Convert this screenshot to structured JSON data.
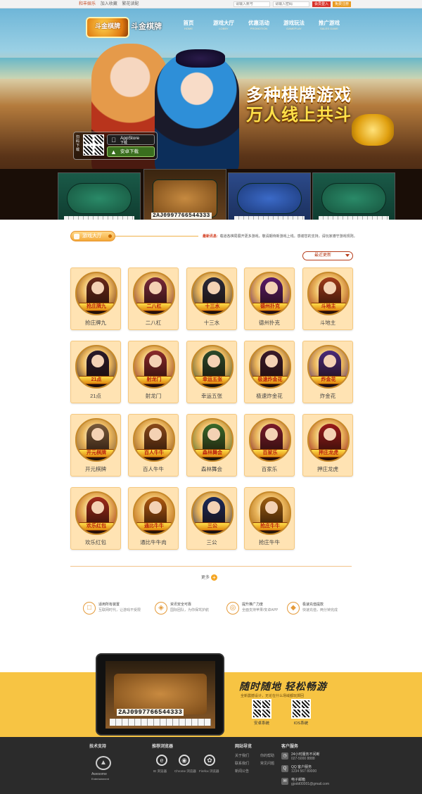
{
  "topbar": {
    "links": [
      "和丰娱乐",
      "加入收藏",
      "繁花读配"
    ],
    "username_placeholder": "请输入账号",
    "password_placeholder": "请输入密码",
    "login_label": "会员登入",
    "register_label": "免费注册"
  },
  "header": {
    "logo_text": "斗金棋牌",
    "logo_en": "DOUJINQIPAI",
    "brand": "斗金棋牌",
    "nav": [
      {
        "cn": "首页",
        "en": "HOME"
      },
      {
        "cn": "游戏大厅",
        "en": "LOBBY"
      },
      {
        "cn": "优惠活动",
        "en": "PROMOTION"
      },
      {
        "cn": "游戏玩法",
        "en": "GAMEPLAY"
      },
      {
        "cn": "推广游戏",
        "en": "SALES GAME"
      }
    ]
  },
  "hero": {
    "slogan_line1": "多种棋牌游戏",
    "slogan_line2": "万人线上共斗",
    "scan_label": "扫码下载",
    "appstore_label": "AppStore",
    "appstore_sub": "下载",
    "android_label": "安卓下载",
    "card_text": "2AJ0997766544333"
  },
  "section": {
    "title": "游戏大厅",
    "news_label": "最新讯息:",
    "news_text": "载道各棋局展开更多游戏，敬请期待新游戏上线。感谢您的支持，请玩家遵守游戏规则。",
    "sort_label": "最近更新"
  },
  "games": [
    {
      "name": "抢庄牌九",
      "banner": "抢庄牌九",
      "color": "#6a2a1a"
    },
    {
      "name": "二八杠",
      "banner": "二八杠",
      "color": "#7a2a3a"
    },
    {
      "name": "十三水",
      "banner": "十三水",
      "color": "#2a2a3a"
    },
    {
      "name": "德州扑克",
      "banner": "德州扑克",
      "color": "#5a1a6a"
    },
    {
      "name": "斗地主",
      "banner": "斗地主",
      "color": "#a03a1a"
    },
    {
      "name": "21点",
      "banner": "21点",
      "color": "#2a1a2a"
    },
    {
      "name": "射龙门",
      "banner": "射龙门",
      "color": "#8a2a2a"
    },
    {
      "name": "幸运五张",
      "banner": "幸运五张",
      "color": "#2a4a2a"
    },
    {
      "name": "极速炸金花",
      "banner": "极速炸金花",
      "color": "#3a1a2a"
    },
    {
      "name": "炸金花",
      "banner": "炸金花",
      "color": "#4a2a7a"
    },
    {
      "name": "开元棋牌",
      "banner": "开元棋牌",
      "color": "#7a5a3a"
    },
    {
      "name": "百人牛牛",
      "banner": "百人牛牛",
      "color": "#8a4a1a"
    },
    {
      "name": "森林舞会",
      "banner": "森林舞会",
      "color": "#3a6a2a"
    },
    {
      "name": "百家乐",
      "banner": "百家乐",
      "color": "#7a1a2a"
    },
    {
      "name": "押庄龙虎",
      "banner": "押庄龙虎",
      "color": "#9a1a1a"
    },
    {
      "name": "欢乐红包",
      "banner": "欢乐红包",
      "color": "#a02a1a"
    },
    {
      "name": "通比牛牛肉",
      "banner": "通比牛牛",
      "color": "#b05a10"
    },
    {
      "name": "三公",
      "banner": "三公",
      "color": "#1a2a5a"
    },
    {
      "name": "抢庄牛牛",
      "banner": "抢庄牛牛",
      "color": "#a06010"
    }
  ],
  "more_label": "更多",
  "features": [
    {
      "t1": "适用所有装置",
      "t2": "互联网时代，让游戏不受限",
      "icon": "□"
    },
    {
      "t1": "资讯安全可靠",
      "t2": "国际团队，为你保驾护航",
      "icon": "◈"
    },
    {
      "t1": "提升推广力度",
      "t2": "全面支持苹果/安卓APP",
      "icon": "◎"
    },
    {
      "t1": "极速充值提款",
      "t2": "快速充值，两分钟完成",
      "icon": "◆"
    }
  ],
  "promo": {
    "title": "随时随地 轻松畅游",
    "subtitle": "全新震撼设计，无论在什么场域都玩掷回",
    "android_label": "安卓系统",
    "ios_label": "IOS系统",
    "card_text": "2AJ0997766544333"
  },
  "footer": {
    "tech_title": "技术支持",
    "tech_name": "Awesome",
    "tech_sub": "Entertainment",
    "browser_title": "推荐浏览器",
    "browsers": [
      "IE 浏览器",
      "Chrome 浏览器",
      "Firefox 浏览器"
    ],
    "nav_title": "网站导览",
    "nav_links": [
      "关于我们",
      "你的帮助",
      "联系我们",
      "常见问题",
      "新闻公告"
    ],
    "service_title": "客户服务",
    "service_items": [
      {
        "label": "24小时服务不间断",
        "value": "027-5000 8888"
      },
      {
        "label": "QQ 客户服务",
        "value": "1234 567 89000"
      },
      {
        "label": "电子邮箱",
        "value": "gjodd00001@gmail.com"
      }
    ]
  }
}
